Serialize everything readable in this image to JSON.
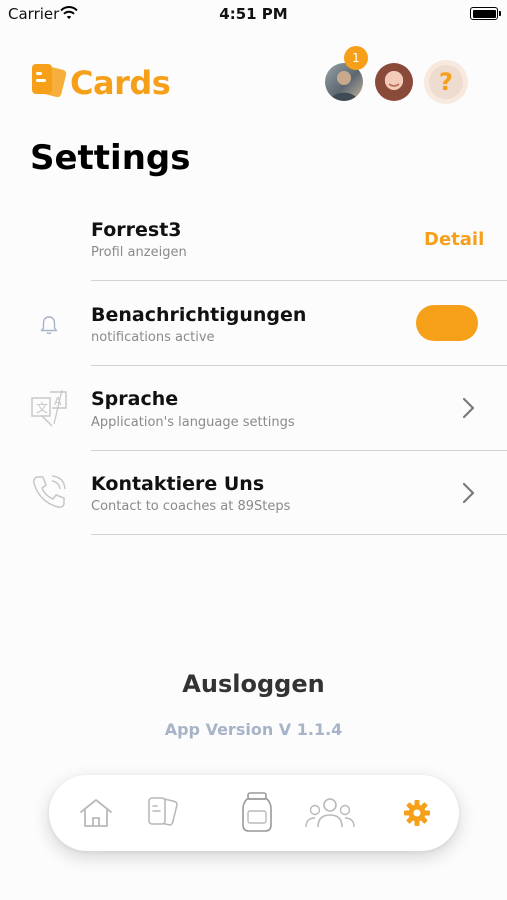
{
  "status_bar": {
    "carrier": "Carrier",
    "time": "4:51 PM"
  },
  "header": {
    "app_name": "Cards",
    "notification_count": "1",
    "help_symbol": "?",
    "brand_color": "#f6a01a"
  },
  "page": {
    "title": "Settings"
  },
  "profile": {
    "name": "Forrest3",
    "subtitle": "Profil anzeigen",
    "detail_label": "Detail"
  },
  "notifications": {
    "title": "Benachrichtigungen",
    "subtitle": "notifications active",
    "enabled": true,
    "icon": "bell-icon"
  },
  "language": {
    "title": "Sprache",
    "subtitle": "Application's language settings",
    "icon": "translate-icon"
  },
  "contact": {
    "title": "Kontaktiere Uns",
    "subtitle": "Contact to coaches at 89Steps",
    "icon": "phone-icon"
  },
  "footer": {
    "logout_label": "Ausloggen",
    "version": "App Version V 1.1.4"
  },
  "tabbar": {
    "items": [
      "home-icon",
      "cards-icon",
      "jar-icon",
      "people-icon",
      "settings-gear-icon"
    ],
    "active": "settings-gear-icon",
    "active_color": "#f6a01a",
    "inactive_color": "#b9b9b9"
  }
}
